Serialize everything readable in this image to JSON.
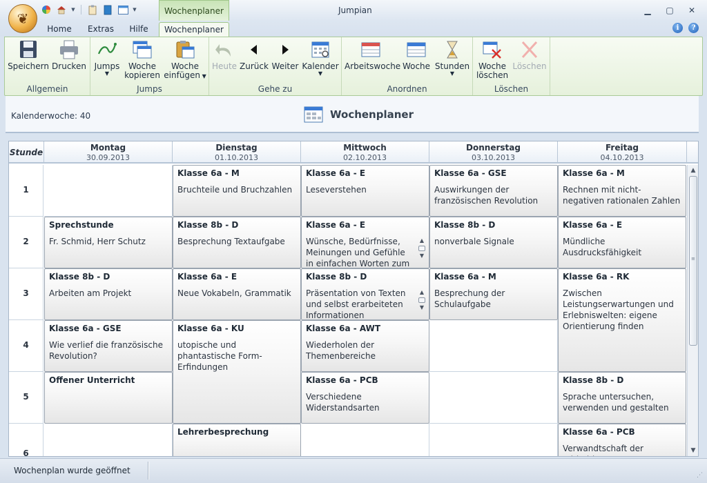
{
  "window": {
    "context_tab": "Wochenplaner",
    "title": "Jumpian",
    "controls": {
      "minimize": "▁",
      "maximize": "▢",
      "close": "✕"
    }
  },
  "tabs": [
    {
      "label": "Home"
    },
    {
      "label": "Extras"
    },
    {
      "label": "Hilfe"
    },
    {
      "label": "Wochenplaner",
      "active": true
    }
  ],
  "ribbon": {
    "groups": [
      {
        "label": "Allgemein"
      },
      {
        "label": "Jumps"
      },
      {
        "label": "Gehe zu"
      },
      {
        "label": "Anordnen"
      },
      {
        "label": "Löschen"
      }
    ],
    "buttons": {
      "speichern": "Speichern",
      "drucken": "Drucken",
      "jumps": "Jumps",
      "woche_kopieren_1": "Woche",
      "woche_kopieren_2": "kopieren",
      "woche_einfuegen_1": "Woche",
      "woche_einfuegen_2": "einfügen",
      "heute": "Heute",
      "zurueck": "Zurück",
      "weiter": "Weiter",
      "kalender": "Kalender",
      "arbeitswoche": "Arbeitswoche",
      "woche": "Woche",
      "stunden": "Stunden",
      "woche_loeschen_1": "Woche",
      "woche_loeschen_2": "löschen",
      "loeschen": "Löschen"
    }
  },
  "subheader": {
    "kalenderwoche": "Kalenderwoche: 40",
    "title": "Wochenplaner"
  },
  "grid": {
    "stunde_label": "Stunde",
    "days": [
      {
        "name": "Montag",
        "date": "30.09.2013"
      },
      {
        "name": "Dienstag",
        "date": "01.10.2013"
      },
      {
        "name": "Mittwoch",
        "date": "02.10.2013"
      },
      {
        "name": "Donnerstag",
        "date": "03.10.2013"
      },
      {
        "name": "Freitag",
        "date": "04.10.2013"
      }
    ],
    "rows": [
      "1",
      "2",
      "3",
      "4",
      "5",
      "6"
    ],
    "lessons": [
      {
        "title": "Klasse 6a - M",
        "desc": "Bruchteile und Bruchzahlen"
      },
      {
        "title": "Klasse 6a - E",
        "desc": "Leseverstehen"
      },
      {
        "title": "Klasse 6a - GSE",
        "desc": "Auswirkungen der französischen Revolution"
      },
      {
        "title": "Klasse 6a - M",
        "desc": "Rechnen mit nicht-negativen rationalen Zahlen"
      },
      {
        "title": "Sprechstunde",
        "desc": "Fr. Schmid, Herr Schutz"
      },
      {
        "title": "Klasse 8b - D",
        "desc": "Besprechung Textaufgabe"
      },
      {
        "title": "Klasse 6a - E",
        "desc": "Wünsche, Bedürfnisse, Meinungen und Gefühle in einfachen Worten zum"
      },
      {
        "title": "Klasse 8b - D",
        "desc": "nonverbale Signale"
      },
      {
        "title": "Klasse 6a - E",
        "desc": "Mündliche Ausdrucksfähigkeit"
      },
      {
        "title": "Klasse 8b - D",
        "desc": "Arbeiten am Projekt"
      },
      {
        "title": "Klasse 6a - E",
        "desc": "Neue Vokabeln, Grammatik"
      },
      {
        "title": "Klasse 8b - D",
        "desc": "Präsentation von Texten und selbst erarbeiteten Informationen"
      },
      {
        "title": "Klasse 6a - M",
        "desc": "Besprechung der Schulaufgabe"
      },
      {
        "title": "Klasse 6a - RK",
        "desc": "Zwischen Leistungserwartungen und Erlebniswelten: eigene Orientierung finden"
      },
      {
        "title": "Klasse 6a - GSE",
        "desc": "Wie verlief die französische Revolution?"
      },
      {
        "title": "Klasse 6a - KU",
        "desc": "utopische und phantastische Form-Erfindungen"
      },
      {
        "title": "Klasse 6a - AWT",
        "desc": "Wiederholen der Themenbereiche"
      },
      {
        "title": "Offener Unterricht",
        "desc": ""
      },
      {
        "title": "Klasse 6a - PCB",
        "desc": "Verschiedene Widerstandsarten"
      },
      {
        "title": "Klasse 8b - D",
        "desc": "Sprache untersuchen, verwenden und gestalten"
      },
      {
        "title": "Lehrerbesprechung",
        "desc": ""
      },
      {
        "title": "Klasse 6a - PCB",
        "desc": "Verwandtschaft der Wirbeltiere"
      }
    ]
  },
  "status": {
    "message": "Wochenplan wurde geöffnet"
  },
  "colors": {
    "ribbon_accent": "#a9ca97",
    "context_tab": "#c9e4b7",
    "lesson_border": "#9aa4b0"
  }
}
